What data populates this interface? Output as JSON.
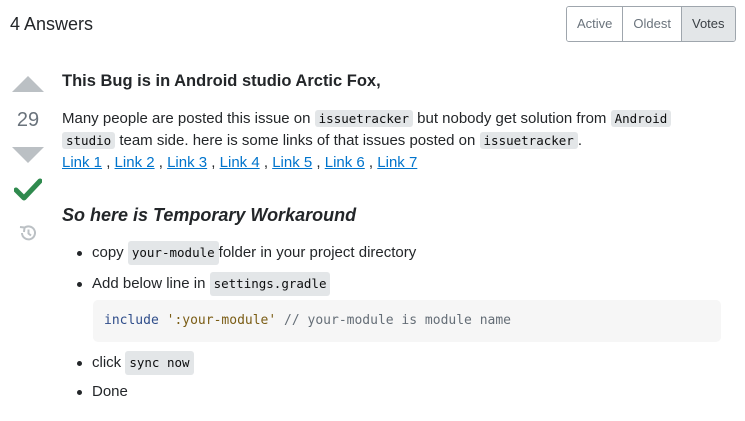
{
  "header": {
    "answers_count": "4 Answers",
    "sort_options": [
      "Active",
      "Oldest",
      "Votes"
    ],
    "active_sort": "Votes"
  },
  "vote": {
    "count": "29",
    "accepted": true,
    "icons": [
      "upvote-arrow",
      "downvote-arrow",
      "accepted-check",
      "history-icon"
    ]
  },
  "post": {
    "title": "This Bug is in Android studio Arctic Fox,",
    "para": {
      "t1": "Many people are posted this issue on ",
      "c1": "issuetracker",
      "t2": " but nobody get solution from ",
      "c2a": "Android",
      "c2b": "studio",
      "t3": " team side. here is some links of that issues posted on ",
      "c3": "issuetracker",
      "t4": "."
    },
    "links": [
      "Link 1",
      "Link 2",
      "Link 3",
      "Link 4",
      "Link 5",
      "Link 6",
      "Link 7"
    ],
    "link_sep": " , ",
    "workaround_heading": "So here is Temporary Workaround",
    "steps": {
      "s1_pre": "copy ",
      "s1_code": "your-module",
      "s1_post": " folder in your project directory",
      "s2_pre": "Add below line in ",
      "s2_code": "settings.gradle",
      "s3_pre": "click ",
      "s3_code": "sync now",
      "s4": "Done"
    },
    "code_block": {
      "keyword": "include",
      "string": "':your-module'",
      "comment": "// your-module is module name"
    }
  },
  "colors": {
    "link": "#0074cc",
    "accepted": "#2f8a4e",
    "vote_arrow": "#bbc0c4"
  }
}
